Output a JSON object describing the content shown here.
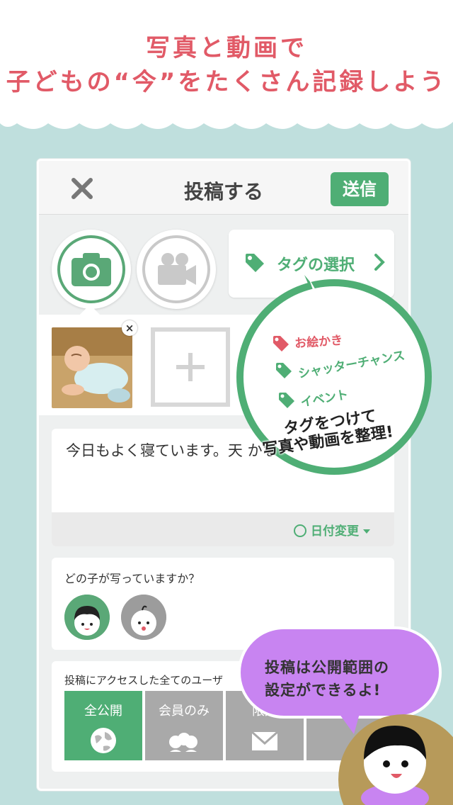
{
  "promo": {
    "line1": "写真と動画で",
    "line2": "子どもの“今”をたくさん記録しよう"
  },
  "nav": {
    "title": "投稿する",
    "close_icon": "close-icon",
    "send_label": "送信"
  },
  "media": {
    "photo_icon": "camera-icon",
    "video_icon": "video-camera-icon",
    "tag_select_label": "タグの選択"
  },
  "tags": {
    "items": [
      "お絵かき",
      "シャッターチャンス",
      "イベント"
    ],
    "caption_line1": "タグをつけて",
    "caption_line2": "写真や動画を整理!"
  },
  "post": {
    "text": "今日もよく寝ています。天 かな？",
    "date_change_label": "日付変更"
  },
  "children": {
    "question": "どの子が写っていますか？"
  },
  "privacy": {
    "description": "投稿にアクセスした全てのユーザ",
    "options": [
      {
        "label": "全公開",
        "icon": "globe-icon"
      },
      {
        "label": "会員のみ",
        "icon": "members-icon"
      },
      {
        "label": "限定",
        "icon": "envelope-icon"
      },
      {
        "label": "",
        "icon": "lock-icon"
      }
    ]
  },
  "bubble": {
    "line1": "投稿は公開範囲の",
    "line2": "設定ができるよ!"
  },
  "colors": {
    "accent_green": "#4fae75",
    "accent_red": "#e15a67",
    "bubble_purple": "#c884f1",
    "background": "#bfdfdd"
  }
}
